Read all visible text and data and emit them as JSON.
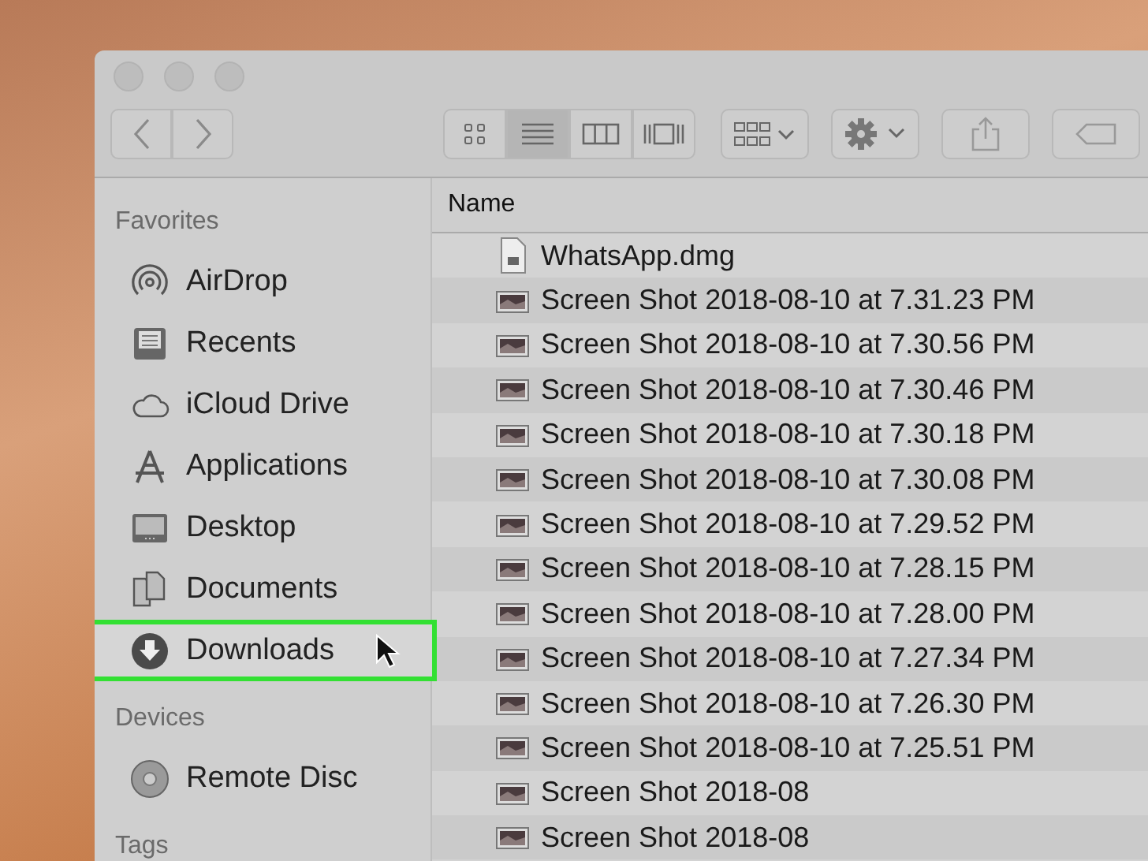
{
  "toolbar": {
    "view_modes": [
      {
        "kind": "icons",
        "selected": false
      },
      {
        "kind": "list",
        "selected": true
      },
      {
        "kind": "columns",
        "selected": false
      },
      {
        "kind": "gallery",
        "selected": false
      }
    ]
  },
  "sidebar": {
    "sections": [
      {
        "title": "Favorites",
        "items": [
          {
            "label": "AirDrop",
            "kind": "airdrop",
            "selected": false
          },
          {
            "label": "Recents",
            "kind": "recents",
            "selected": false
          },
          {
            "label": "iCloud Drive",
            "kind": "cloud",
            "selected": false
          },
          {
            "label": "Applications",
            "kind": "apps",
            "selected": false
          },
          {
            "label": "Desktop",
            "kind": "desktop",
            "selected": false
          },
          {
            "label": "Documents",
            "kind": "documents",
            "selected": false
          },
          {
            "label": "Downloads",
            "kind": "downloads",
            "selected": true
          }
        ]
      },
      {
        "title": "Devices",
        "items": [
          {
            "label": "Remote Disc",
            "kind": "disc",
            "selected": false
          }
        ]
      },
      {
        "title": "Tags"
      }
    ]
  },
  "file_list": {
    "column": "Name",
    "rows": [
      {
        "name": "WhatsApp.dmg",
        "kind": "dmg"
      },
      {
        "name": "Screen Shot 2018-08-10 at 7.31.23 PM",
        "kind": "image"
      },
      {
        "name": "Screen Shot 2018-08-10 at 7.30.56 PM",
        "kind": "image"
      },
      {
        "name": "Screen Shot 2018-08-10 at 7.30.46 PM",
        "kind": "image"
      },
      {
        "name": "Screen Shot 2018-08-10 at 7.30.18 PM",
        "kind": "image"
      },
      {
        "name": "Screen Shot 2018-08-10 at 7.30.08 PM",
        "kind": "image"
      },
      {
        "name": "Screen Shot 2018-08-10 at 7.29.52 PM",
        "kind": "image"
      },
      {
        "name": "Screen Shot 2018-08-10 at 7.28.15 PM",
        "kind": "image"
      },
      {
        "name": "Screen Shot 2018-08-10 at 7.28.00 PM",
        "kind": "image"
      },
      {
        "name": "Screen Shot 2018-08-10 at 7.27.34 PM",
        "kind": "image"
      },
      {
        "name": "Screen Shot 2018-08-10 at 7.26.30 PM",
        "kind": "image"
      },
      {
        "name": "Screen Shot 2018-08-10 at 7.25.51 PM",
        "kind": "image"
      },
      {
        "name": "Screen Shot 2018-08",
        "kind": "image"
      },
      {
        "name": "Screen Shot 2018-08",
        "kind": "image"
      }
    ]
  }
}
